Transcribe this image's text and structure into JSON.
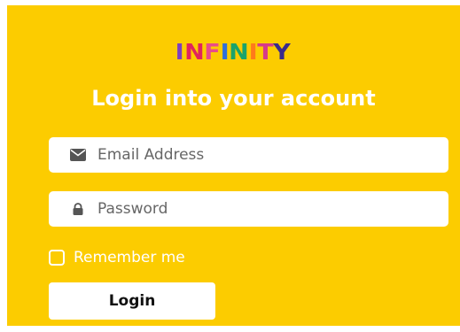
{
  "brand": {
    "letters": [
      {
        "char": "I",
        "color": "#7b3fbf"
      },
      {
        "char": "N",
        "color": "#e0245e"
      },
      {
        "char": "F",
        "color": "#e84c8a"
      },
      {
        "char": "I",
        "color": "#2f6fdc"
      },
      {
        "char": "N",
        "color": "#1aa36b"
      },
      {
        "char": "I",
        "color": "#ff7a1a"
      },
      {
        "char": "T",
        "color": "#d63a8a"
      },
      {
        "char": "Y",
        "color": "#3a2a8c"
      }
    ]
  },
  "heading": "Login into your account",
  "form": {
    "email_placeholder": "Email Address",
    "email_icon": "envelope-icon",
    "password_placeholder": "Password",
    "password_icon": "lock-icon",
    "remember_label": "Remember me",
    "remember_checked": false,
    "login_label": "Login"
  },
  "colors": {
    "background": "#fccc00",
    "field_bg": "#ffffff",
    "text_white": "#ffffff"
  }
}
